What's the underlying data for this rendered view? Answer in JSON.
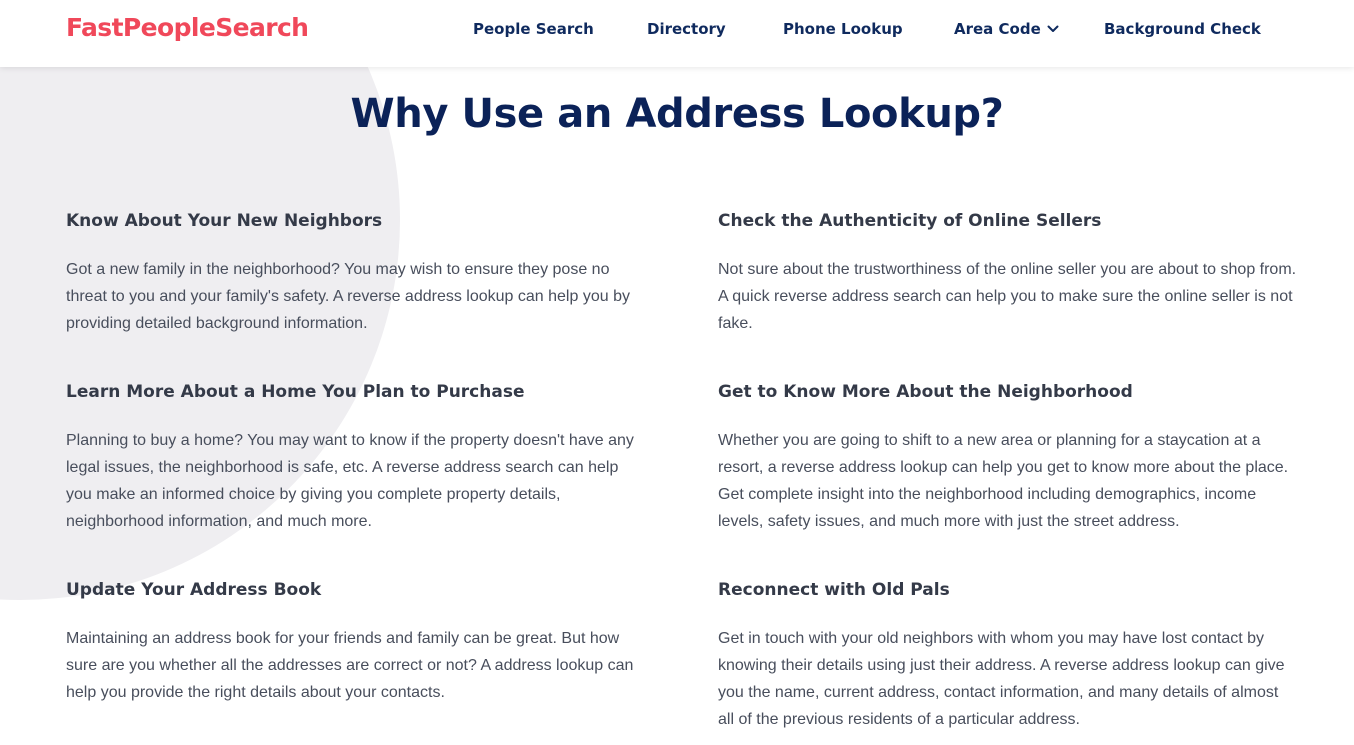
{
  "header": {
    "logo": "FastPeopleSearch",
    "nav": [
      {
        "label": "People Search"
      },
      {
        "label": "Directory"
      },
      {
        "label": "Phone Lookup"
      },
      {
        "label": "Area Code",
        "icon": "chevron-down-icon"
      },
      {
        "label": "Background Check"
      }
    ]
  },
  "main": {
    "title": "Why Use an Address Lookup?",
    "sections": [
      {
        "heading": "Know About Your New Neighbors",
        "text": "Got a new family in the neighborhood? You may wish to ensure they pose no threat to you and your family's safety. A reverse address lookup can help you by providing detailed background information."
      },
      {
        "heading": "Check the Authenticity of Online Sellers",
        "text": "Not sure about the trustworthiness of the online seller you are about to shop from. A quick reverse address search can help you to make sure the online seller is not fake."
      },
      {
        "heading": "Learn More About a Home You Plan to Purchase",
        "text": "Planning to buy a home? You may want to know if the property doesn't have any legal issues, the neighborhood is safe, etc. A reverse address search can help you make an informed choice by giving you complete property details, neighborhood information, and much more."
      },
      {
        "heading": "Get to Know More About the Neighborhood",
        "text": "Whether you are going to shift to a new area or planning for a staycation at a resort, a reverse address lookup can help you get to know more about the place. Get complete insight into the neighborhood including demographics, income levels, safety issues, and much more with just the street address."
      },
      {
        "heading": "Update Your Address Book",
        "text": "Maintaining an address book for your friends and family can be great. But how sure are you whether all the addresses are correct or not? A address lookup can help you provide the right details about your contacts."
      },
      {
        "heading": "Reconnect with Old Pals",
        "text": "Get in touch with your old neighbors with whom you may have lost contact by knowing their details using just their address. A reverse address lookup can give you the name, current address, contact information, and many details of almost all of the previous residents of a particular address."
      }
    ]
  },
  "colors": {
    "brand": "#f0485a",
    "nav": "#0f2a5e",
    "title": "#0b2258",
    "heading": "#343a48",
    "body": "#484e5c",
    "background_circle": "#efeef1"
  }
}
